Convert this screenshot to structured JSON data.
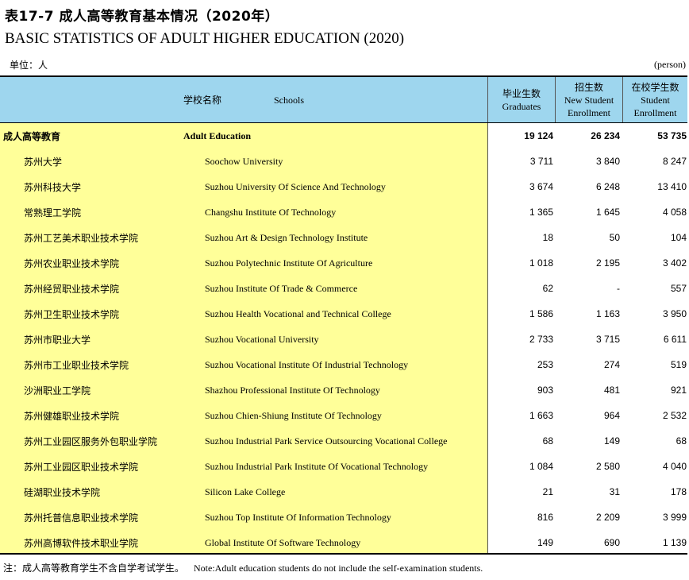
{
  "title_cn": "表17-7  成人高等教育基本情况（2020年）",
  "title_en": "BASIC STATISTICS OF ADULT HIGHER EDUCATION (2020)",
  "unit_cn": "单位：人",
  "unit_en": "(person)",
  "header": {
    "school_cn": "学校名称",
    "school_en": "Schools",
    "graduates_cn": "毕业生数",
    "graduates_en": "Graduates",
    "new_cn": "招生数",
    "new_en1": "New Student",
    "new_en2": "Enrollment",
    "enrolled_cn": "在校学生数",
    "enrolled_en1": "Student",
    "enrolled_en2": "Enrollment"
  },
  "rows": [
    {
      "cn": "成人高等教育",
      "en": "Adult Education",
      "graduates": "19 124",
      "new": "26 234",
      "enrolled": "53 735"
    },
    {
      "cn": "苏州大学",
      "en": "Soochow University",
      "graduates": "3 711",
      "new": "3 840",
      "enrolled": "8 247"
    },
    {
      "cn": "苏州科技大学",
      "en": "Suzhou University Of Science And Technology",
      "graduates": "3 674",
      "new": "6 248",
      "enrolled": "13 410"
    },
    {
      "cn": "常熟理工学院",
      "en": "Changshu Institute Of Technology",
      "graduates": "1 365",
      "new": "1 645",
      "enrolled": "4 058"
    },
    {
      "cn": "苏州工艺美术职业技术学院",
      "en": "Suzhou Art & Design Technology Institute",
      "graduates": "18",
      "new": "50",
      "enrolled": "104"
    },
    {
      "cn": "苏州农业职业技术学院",
      "en": "Suzhou Polytechnic Institute Of Agriculture",
      "graduates": "1 018",
      "new": "2 195",
      "enrolled": "3 402"
    },
    {
      "cn": "苏州经贸职业技术学院",
      "en": "Suzhou Institute Of Trade & Commerce",
      "graduates": "62",
      "new": "-",
      "enrolled": "557"
    },
    {
      "cn": "苏州卫生职业技术学院",
      "en": "Suzhou Health Vocational and Technical College",
      "graduates": "1 586",
      "new": "1 163",
      "enrolled": "3 950"
    },
    {
      "cn": "苏州市职业大学",
      "en": "Suzhou Vocational University",
      "graduates": "2 733",
      "new": "3 715",
      "enrolled": "6 611"
    },
    {
      "cn": "苏州市工业职业技术学院",
      "en": "Suzhou Vocational Institute Of Industrial Technology",
      "graduates": "253",
      "new": "274",
      "enrolled": "519"
    },
    {
      "cn": "沙洲职业工学院",
      "en": "Shazhou Professional Institute Of Technology",
      "graduates": "903",
      "new": "481",
      "enrolled": "921"
    },
    {
      "cn": "苏州健雄职业技术学院",
      "en": "Suzhou Chien-Shiung Institute  Of  Technology",
      "graduates": "1 663",
      "new": "964",
      "enrolled": "2 532"
    },
    {
      "cn": "苏州工业园区服务外包职业学院",
      "en": "Suzhou Industrial Park Service Outsourcing Vocational College",
      "graduates": "68",
      "new": "149",
      "enrolled": "68"
    },
    {
      "cn": "苏州工业园区职业技术学院",
      "en": "Suzhou Industrial Park Institute Of Vocational Technology",
      "graduates": "1 084",
      "new": "2 580",
      "enrolled": "4 040"
    },
    {
      "cn": "硅湖职业技术学院",
      "en": "Silicon Lake College",
      "graduates": "21",
      "new": "31",
      "enrolled": "178"
    },
    {
      "cn": "苏州托普信息职业技术学院",
      "en": "Suzhou Top Institute Of Information Technology",
      "graduates": "816",
      "new": "2 209",
      "enrolled": "3 999"
    },
    {
      "cn": "苏州高博软件技术职业学院",
      "en": "Global Institute Of Software Technology",
      "graduates": "149",
      "new": "690",
      "enrolled": "1 139"
    }
  ],
  "note_cn": "注：成人高等教育学生不含自学考试学生。",
  "note_en": "Note:Adult education students do not include the self-examination students."
}
